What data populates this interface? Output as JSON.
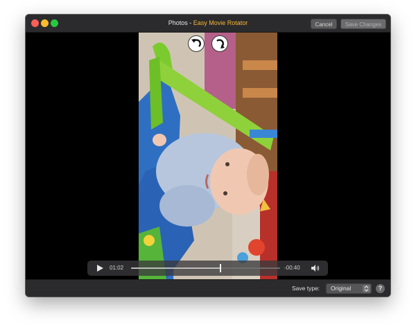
{
  "window": {
    "title_prefix": "Photos",
    "title_separator": "-",
    "title_app": "Easy Movie Rotator"
  },
  "toolbar": {
    "cancel_label": "Cancel",
    "save_label": "Save Changes"
  },
  "playback": {
    "elapsed": "01:02",
    "remaining": "-00:40",
    "progress_fraction": 0.6
  },
  "footer": {
    "save_type_label": "Save type:",
    "save_type_value": "Original",
    "help_label": "?"
  },
  "colors": {
    "accent_title": "#f7b733",
    "window_bg": "#000000",
    "bar_bg": "#2b2b2d"
  },
  "icons": {
    "rotate_left": "rotate-counterclockwise-icon",
    "rotate_right": "rotate-clockwise-icon",
    "play": "play-icon",
    "volume": "speaker-icon",
    "select_arrows": "chevron-updown-icon"
  }
}
